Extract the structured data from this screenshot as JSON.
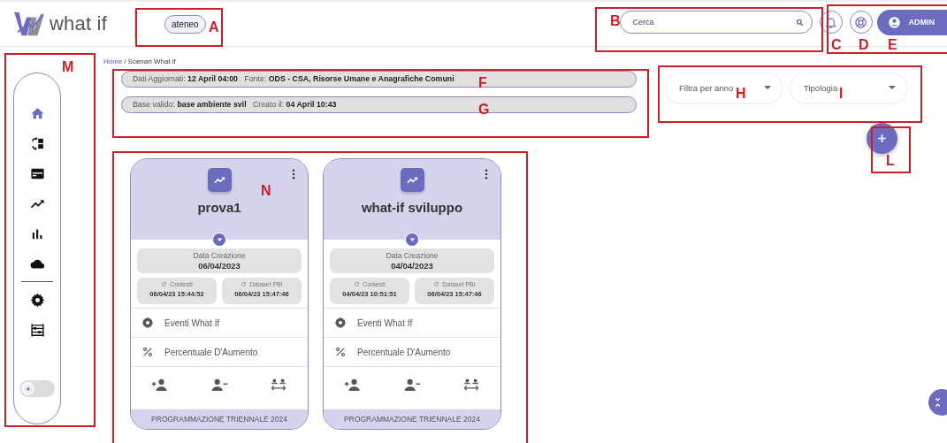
{
  "header": {
    "logo_text": "what if",
    "context_chip": "ateneo",
    "search": {
      "placeholder": "Cerca"
    },
    "user_button": "ADMIN"
  },
  "sidebar": {
    "groups": [
      [
        {
          "kind": "home",
          "selected": true
        },
        {
          "kind": "swap",
          "selected": false
        },
        {
          "kind": "card",
          "selected": false
        },
        {
          "kind": "trend",
          "selected": false
        },
        {
          "kind": "bars",
          "selected": false
        },
        {
          "kind": "cloud",
          "selected": false
        }
      ],
      [
        {
          "kind": "gear",
          "selected": false
        },
        {
          "kind": "abacus",
          "selected": false
        }
      ]
    ],
    "theme_toggle": {
      "on": false
    }
  },
  "breadcrumb": {
    "link": "Home",
    "separator": "/",
    "current": "Scenari What if"
  },
  "info_pills": [
    {
      "parts": [
        "Dati Aggiornati: ",
        "**12 April 04:00**",
        "   Fonte: ",
        "**ODS - CSA, Risorse Umane e Anagrafiche Comuni**"
      ]
    },
    {
      "parts": [
        "Base valido: ",
        "**base ambiente svil**",
        "   Creato il: ",
        "**04 April 10:43**"
      ]
    }
  ],
  "filters": [
    {
      "placeholder": "Filtra per anno"
    },
    {
      "placeholder": "Tipologia"
    }
  ],
  "cards": [
    {
      "title": "prova1",
      "created_label": "Data Creazione",
      "created_value": "06/04/2023",
      "stats": [
        {
          "label": "Contesti",
          "value": "06/04/23 15:44:52"
        },
        {
          "label": "Dataset PBI",
          "value": "06/04/23 15:47:46"
        }
      ],
      "menu": [
        {
          "kind": "gear",
          "label": "Eventi What If"
        },
        {
          "kind": "percent",
          "label": "Percentuale D'Aumento"
        }
      ],
      "footer": "PROGRAMMAZIONE TRIENNALE 2024"
    },
    {
      "title": "what-if sviluppo",
      "created_label": "Data Creazione",
      "created_value": "04/04/2023",
      "stats": [
        {
          "label": "Contesti",
          "value": "04/04/23 10:51:51"
        },
        {
          "label": "Dataset PBI",
          "value": "06/04/23 15:47:46"
        }
      ],
      "menu": [
        {
          "kind": "gear",
          "label": "Eventi What If"
        },
        {
          "kind": "percent",
          "label": "Percentuale D'Aumento"
        }
      ],
      "footer": "PROGRAMMAZIONE TRIENNALE 2024"
    }
  ],
  "annotations": [
    {
      "labels": [
        "A"
      ]
    },
    {
      "labels": [
        "B"
      ]
    },
    {
      "labels": [
        "C",
        "D",
        "E"
      ]
    },
    {
      "labels": [
        "M"
      ]
    },
    {
      "labels": [
        "F",
        "G"
      ]
    },
    {
      "labels": [
        "H",
        "I"
      ]
    },
    {
      "labels": [
        "L"
      ]
    },
    {
      "labels": [
        "N"
      ]
    }
  ]
}
